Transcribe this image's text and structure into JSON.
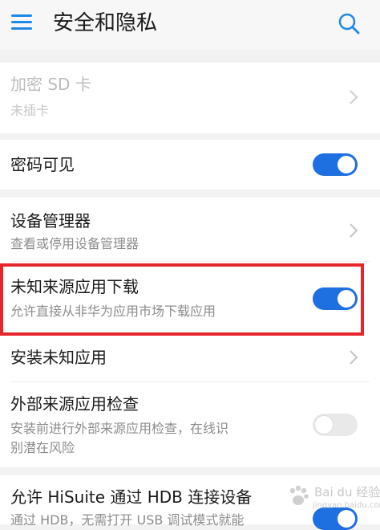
{
  "header": {
    "title": "安全和隐私",
    "menu_icon": "menu-icon",
    "search_icon": "search-icon"
  },
  "items": [
    {
      "title": "加密 SD 卡",
      "subtitle": "未插卡",
      "control": "chevron",
      "disabled": true
    },
    {
      "title": "密码可见",
      "control": "toggle",
      "state": "on"
    },
    {
      "title": "设备管理器",
      "subtitle": "查看或停用设备管理器",
      "control": "chevron"
    },
    {
      "title": "未知来源应用下载",
      "subtitle": "允许直接从非华为应用市场下载应用",
      "control": "toggle",
      "state": "on",
      "highlighted": true
    },
    {
      "title": "安装未知应用",
      "control": "chevron"
    },
    {
      "title": "外部来源应用检查",
      "subtitle_line1": "安装前进行外部来源应用检查，在线识",
      "subtitle_line2": "别潜在风险",
      "control": "toggle",
      "state": "off"
    },
    {
      "title": "允许 HiSuite 通过 HDB 连接设备",
      "subtitle": "通过 HDB，无需打开 USB 调试模式就能",
      "control": "toggle",
      "state": "on"
    }
  ],
  "watermark": {
    "text": "Bai du 经验",
    "subtext": "jingyan.baidu.com"
  },
  "colors": {
    "accent": "#1e6fe0",
    "highlight_border": "#e5262b",
    "toggle_off": "#e9e9e9"
  }
}
